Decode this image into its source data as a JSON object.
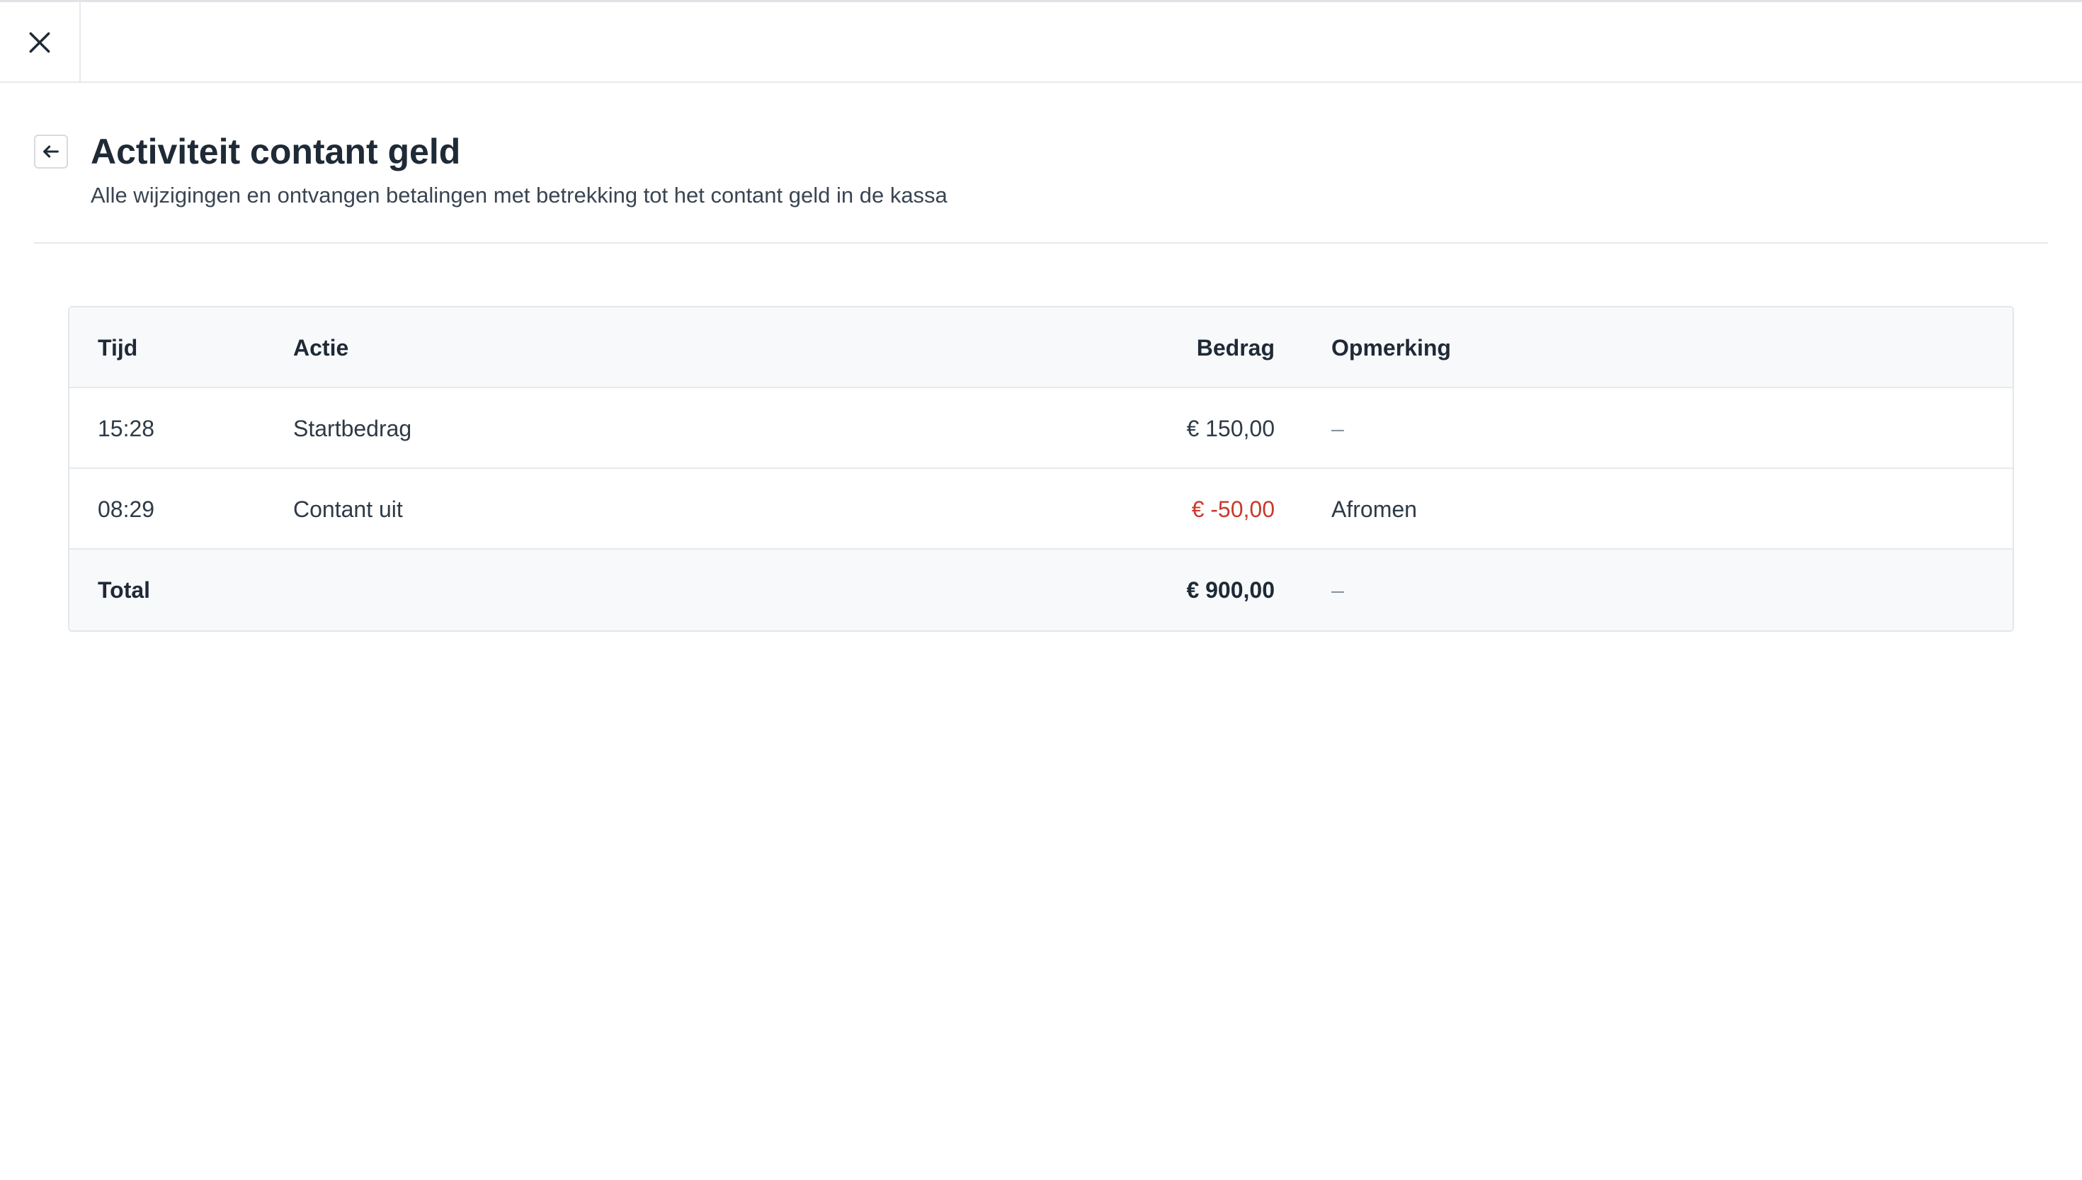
{
  "header": {
    "title": "Activiteit contant geld",
    "subtitle": "Alle wijzigingen en ontvangen betalingen met betrekking tot het contant geld in de kassa"
  },
  "icons": {
    "close": "close-icon",
    "back": "arrow-left-icon"
  },
  "table": {
    "columns": {
      "time": "Tijd",
      "action": "Actie",
      "amount": "Bedrag",
      "note": "Opmerking"
    },
    "rows": [
      {
        "time": "15:28",
        "action": "Startbedrag",
        "amount": "€ 150,00",
        "note": "–"
      },
      {
        "time": "08:29",
        "action": "Contant uit",
        "amount": "€ -50,00",
        "note": "Afromen"
      }
    ],
    "total": {
      "label": "Total",
      "amount": "€ 900,00",
      "note": "–"
    }
  },
  "colors": {
    "text": "#1f2a37",
    "negative": "#c83a2b",
    "header_bg": "#f8f9fb",
    "border": "#e6e9ed"
  }
}
